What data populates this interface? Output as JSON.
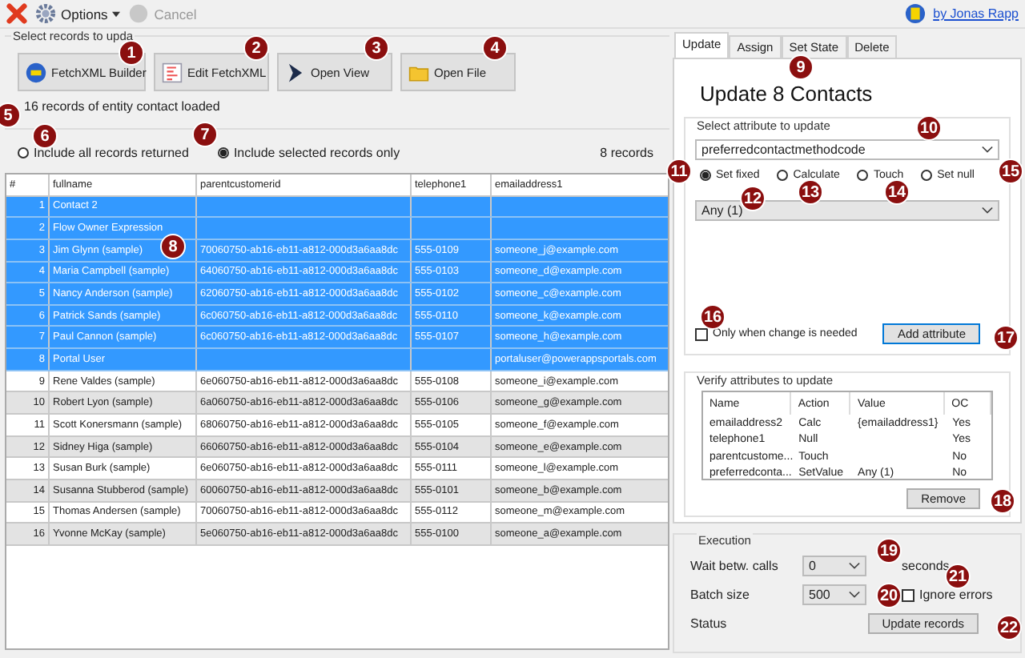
{
  "toolbar": {
    "items": [
      {
        "kind": "close"
      },
      {
        "kind": "options",
        "label": "Options"
      },
      {
        "kind": "cancel",
        "label": "Cancel",
        "disabled": true
      }
    ],
    "link": "by Jonas Rapp"
  },
  "source": {
    "title": "Select records to upda",
    "buttons": [
      {
        "kind": "fxb",
        "label": "FetchXML Builder"
      },
      {
        "kind": "edit",
        "label": "Edit FetchXML"
      },
      {
        "kind": "view",
        "label": "Open View"
      },
      {
        "kind": "file",
        "label": "Open File"
      }
    ],
    "status": "16 records of entity contact loaded"
  },
  "records": {
    "options": [
      {
        "label": "Include all records returned",
        "selected": false
      },
      {
        "label": "Include selected records only",
        "selected": true
      }
    ],
    "count": "8 records",
    "columns": [
      "#",
      "fullname",
      "parentcustomerid",
      "telephone1",
      "emailaddress1"
    ],
    "rows": [
      {
        "cells": [
          "1",
          "Contact 2",
          "",
          "",
          ""
        ],
        "selected": true
      },
      {
        "cells": [
          "2",
          "Flow Owner Expression",
          "",
          "",
          ""
        ],
        "selected": true
      },
      {
        "cells": [
          "3",
          "Jim Glynn (sample)",
          "70060750-ab16-eb11-a812-000d3a6aa8dc",
          "555-0109",
          "someone_j@example.com"
        ],
        "selected": true
      },
      {
        "cells": [
          "4",
          "Maria Campbell (sample)",
          "64060750-ab16-eb11-a812-000d3a6aa8dc",
          "555-0103",
          "someone_d@example.com"
        ],
        "selected": true
      },
      {
        "cells": [
          "5",
          "Nancy Anderson (sample)",
          "62060750-ab16-eb11-a812-000d3a6aa8dc",
          "555-0102",
          "someone_c@example.com"
        ],
        "selected": true
      },
      {
        "cells": [
          "6",
          "Patrick Sands (sample)",
          "6c060750-ab16-eb11-a812-000d3a6aa8dc",
          "555-0110",
          "someone_k@example.com"
        ],
        "selected": true
      },
      {
        "cells": [
          "7",
          "Paul Cannon (sample)",
          "6c060750-ab16-eb11-a812-000d3a6aa8dc",
          "555-0107",
          "someone_h@example.com"
        ],
        "selected": true
      },
      {
        "cells": [
          "8",
          "Portal User",
          "",
          "",
          "portaluser@powerappsportals.com"
        ],
        "selected": true
      },
      {
        "cells": [
          "9",
          "Rene Valdes (sample)",
          "6e060750-ab16-eb11-a812-000d3a6aa8dc",
          "555-0108",
          "someone_i@example.com"
        ],
        "selected": false
      },
      {
        "cells": [
          "10",
          "Robert Lyon (sample)",
          "6a060750-ab16-eb11-a812-000d3a6aa8dc",
          "555-0106",
          "someone_g@example.com"
        ],
        "selected": false
      },
      {
        "cells": [
          "11",
          "Scott Konersmann (sample)",
          "68060750-ab16-eb11-a812-000d3a6aa8dc",
          "555-0105",
          "someone_f@example.com"
        ],
        "selected": false
      },
      {
        "cells": [
          "12",
          "Sidney Higa (sample)",
          "66060750-ab16-eb11-a812-000d3a6aa8dc",
          "555-0104",
          "someone_e@example.com"
        ],
        "selected": false
      },
      {
        "cells": [
          "13",
          "Susan Burk (sample)",
          "6e060750-ab16-eb11-a812-000d3a6aa8dc",
          "555-0111",
          "someone_l@example.com"
        ],
        "selected": false
      },
      {
        "cells": [
          "14",
          "Susanna Stubberod (sample)",
          "60060750-ab16-eb11-a812-000d3a6aa8dc",
          "555-0101",
          "someone_b@example.com"
        ],
        "selected": false
      },
      {
        "cells": [
          "15",
          "Thomas Andersen (sample)",
          "70060750-ab16-eb11-a812-000d3a6aa8dc",
          "555-0112",
          "someone_m@example.com"
        ],
        "selected": false
      },
      {
        "cells": [
          "16",
          "Yvonne McKay (sample)",
          "5e060750-ab16-eb11-a812-000d3a6aa8dc",
          "555-0100",
          "someone_a@example.com"
        ],
        "selected": false
      }
    ]
  },
  "tabs": [
    {
      "label": "Update",
      "selected": true
    },
    {
      "label": "Assign",
      "selected": false
    },
    {
      "label": "Set State",
      "selected": false
    },
    {
      "label": "Delete",
      "selected": false
    }
  ],
  "heading": "Update 8 Contacts",
  "attribute": {
    "title": "Select attribute to update",
    "field": "preferredcontactmethodcode",
    "modes": [
      {
        "label": "Set fixed",
        "selected": true
      },
      {
        "label": "Calculate",
        "selected": false
      },
      {
        "label": "Touch",
        "selected": false
      },
      {
        "label": "Set null",
        "selected": false
      }
    ],
    "value": "Any (1)",
    "only_changed": {
      "label": "Only when change is needed",
      "checked": false
    },
    "add_button": "Add attribute"
  },
  "verify": {
    "title": "Verify attributes to update",
    "columns": [
      "Name",
      "Action",
      "Value",
      "OC"
    ],
    "rows": [
      [
        "emailaddress2",
        "Calc",
        "{emailaddress1}",
        "Yes"
      ],
      [
        "telephone1",
        "Null",
        "",
        "Yes"
      ],
      [
        "parentcustome...",
        "Touch",
        "",
        "No"
      ],
      [
        "preferredconta...",
        "SetValue",
        "Any (1)",
        "No"
      ]
    ],
    "remove_button": "Remove"
  },
  "execution": {
    "title": "Execution",
    "wait_label": "Wait betw. calls",
    "wait_value": "0",
    "wait_unit": "seconds",
    "batch_label": "Batch size",
    "batch_value": "500",
    "ignore": {
      "label": "Ignore errors",
      "checked": false
    },
    "status_label": "Status",
    "update_button": "Update records"
  },
  "callouts": [
    "1",
    "2",
    "3",
    "4",
    "5",
    "6",
    "7",
    "8",
    "9",
    "10",
    "11",
    "12",
    "13",
    "14",
    "15",
    "16",
    "17",
    "18",
    "19",
    "20",
    "21",
    "22"
  ]
}
